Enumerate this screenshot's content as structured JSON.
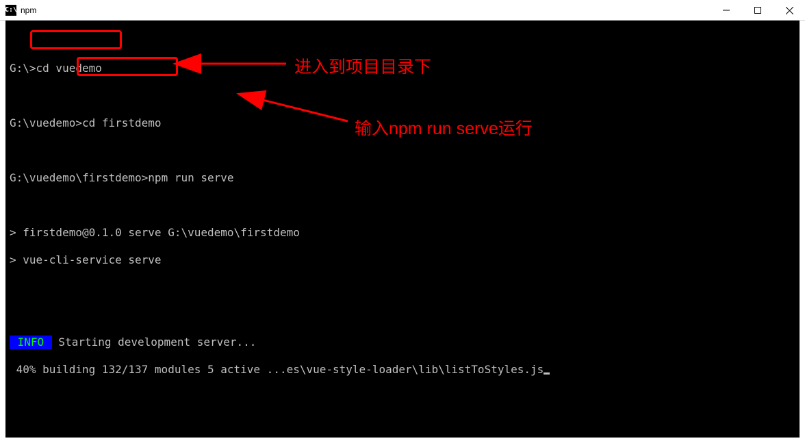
{
  "window": {
    "title": "npm",
    "icon_label": "C:\\"
  },
  "terminal": {
    "lines": {
      "l0": "",
      "l1_prompt": "G:\\>",
      "l1_cmd": "cd vuedemo",
      "l2": "",
      "l3_prompt": "G:\\vuedemo>",
      "l3_cmd": "cd firstdemo",
      "l4": "",
      "l5_prompt": "G:\\vuedemo\\firstdemo>",
      "l5_cmd": "npm run serve",
      "l6": "",
      "l7": "> firstdemo@0.1.0 serve G:\\vuedemo\\firstdemo",
      "l8": "> vue-cli-service serve",
      "l9": "",
      "l10": "",
      "info_badge": " INFO ",
      "l11_rest": " Starting development server...",
      "l12": " 40% building 132/137 modules 5 active ...es\\vue-style-loader\\lib\\listToStyles.js"
    }
  },
  "annotations": {
    "a1": "进入到项目目录下",
    "a2": "输入npm run  serve运行"
  }
}
